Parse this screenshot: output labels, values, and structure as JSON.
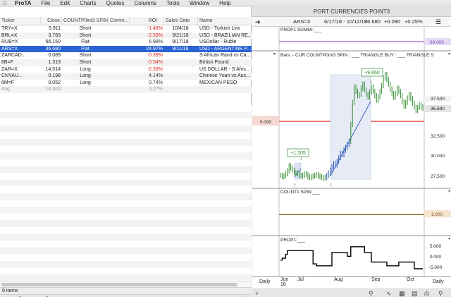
{
  "menubar": {
    "apple_icon": "apple-icon",
    "app_name": "ProTA",
    "items": [
      "File",
      "Edit",
      "Charts",
      "Quotes",
      "Columns",
      "Tools",
      "Window",
      "Help"
    ]
  },
  "table": {
    "columns": [
      "Ticker",
      "Close",
      "COUNTP0int3 SPIN",
      "Comm...",
      "ROI",
      "Sales Date",
      "Name"
    ],
    "rows": [
      {
        "ticker": "TRY=X",
        "close": "5.911",
        "spin": "Short",
        "comm": "",
        "roi": "-1.48%",
        "date": "10/4/18",
        "name": "USD - Turkish Lira"
      },
      {
        "ticker": "BRL=X",
        "close": "3.783",
        "spin": "Short",
        "comm": "",
        "roi": "-2.59%",
        "date": "9/21/18",
        "name": "USD - BRAZILIAN RE..."
      },
      {
        "ticker": "RUB=X",
        "close": "66.150",
        "spin": "Flat",
        "comm": "",
        "roi": "6.98%",
        "date": "9/17/18",
        "name": "USDollar - Ruble"
      },
      {
        "ticker": "ARS=X",
        "close": "36.680",
        "spin": "Flat",
        "comm": "",
        "roi": "24.97%",
        "date": "9/11/18",
        "name": "USD - ARGENTINE P..."
      },
      {
        "ticker": "ZARCAD...",
        "close": "0.089",
        "spin": "Short",
        "comm": "",
        "roi": "-0.39%",
        "date": "",
        "name": "S African Rand vs Ca..."
      },
      {
        "ticker": "6B=F",
        "close": "1.319",
        "spin": "Short",
        "comm": "",
        "roi": "-0.54%",
        "date": "",
        "name": "British Pound"
      },
      {
        "ticker": "ZAR=X",
        "close": "14.514",
        "spin": "Long",
        "comm": "",
        "roi": "-2.39%",
        "date": "",
        "name": "US DOLLAR - S Afric..."
      },
      {
        "ticker": "CNYAU...",
        "close": "0.198",
        "spin": "Long",
        "comm": "",
        "roi": "4.14%",
        "date": "",
        "name": "Chinese Yuan vs Aus..."
      },
      {
        "ticker": "6M=F",
        "close": "0.052",
        "spin": "Long",
        "comm": "",
        "roi": "0.74%",
        "date": "",
        "name": "MEXICAN PESO"
      }
    ],
    "avg": {
      "label": "Avg",
      "close": "14.300",
      "roi": "3.27%"
    },
    "selected_index": 3
  },
  "status": {
    "items_count": "9 items"
  },
  "chart": {
    "window_title": "PORT CURRENCIES POINT3",
    "ticker": "ARS=X",
    "date_range": "6/17/18 - 10/12/18",
    "last": "36.680",
    "change": "+0.090",
    "change_pct": "+0.25%",
    "panel1_label": "PROP1 SUM60:___",
    "panel1_value": "60.000",
    "panel2_label": "Bars:  - CUR COUNTP0int3 SPIN : ___  TRIANGLE BUY : ___  TRIANGLE S",
    "panel2_left_value": "0.000",
    "panel2_ticks": [
      "37.500",
      "35.000",
      "32.500",
      "30.000",
      "27.500"
    ],
    "panel2_last": "36.680",
    "annotation_1": "+1.205",
    "annotation_2": "+9.660",
    "panel3_label": "COUNT1 SPIN:___",
    "panel3_value": "1.000",
    "panel4_label": "PROP1:___",
    "panel4_ticks": [
      "5.000",
      "0.000",
      "-5.000"
    ],
    "x_labels": [
      "Jun",
      "Jul",
      "Aug",
      "Sep",
      "Oct"
    ],
    "x_year": "18",
    "period_left": "Daily",
    "period_right": "Daily"
  },
  "chart_data": {
    "type": "line",
    "title": "",
    "xlabel": "",
    "ylabel": "",
    "ylim": [
      26.5,
      42.5
    ],
    "price_series": {
      "name": "",
      "x": [
        0,
        1,
        2,
        3,
        4,
        5,
        6,
        7,
        8,
        9,
        10,
        11,
        12,
        13,
        14,
        15,
        16,
        17,
        18,
        19,
        20,
        21,
        22,
        23,
        24,
        25,
        26,
        27,
        28,
        29,
        30,
        31,
        32,
        33,
        34,
        35,
        36,
        37,
        38,
        39,
        40,
        41,
        42,
        43,
        44,
        45,
        46,
        47,
        48,
        49,
        50,
        51,
        52,
        53,
        54,
        55,
        56,
        57,
        58,
        59,
        60,
        61,
        62,
        63,
        64,
        65,
        66,
        67,
        68,
        69,
        70,
        71,
        72,
        73,
        74,
        75,
        76,
        77,
        78,
        79,
        80,
        81,
        82,
        83
      ],
      "values": [
        27.6,
        27.4,
        27.5,
        27.8,
        28.2,
        28.9,
        28.6,
        28.3,
        28.0,
        27.9,
        27.8,
        27.6,
        27.5,
        27.6,
        27.8,
        27.7,
        27.4,
        27.3,
        27.4,
        27.5,
        27.6,
        27.7,
        27.5,
        27.4,
        27.3,
        27.2,
        27.3,
        27.6,
        27.9,
        28.3,
        28.8,
        29.2,
        29.0,
        29.5,
        30.0,
        30.6,
        30.4,
        31.0,
        31.4,
        31.8,
        32.2,
        34.5,
        37.5,
        39.6,
        39.0,
        38.4,
        38.6,
        39.4,
        40.0,
        39.2,
        38.6,
        38.2,
        38.9,
        39.6,
        39.0,
        38.4,
        37.8,
        38.3,
        39.0,
        39.8,
        40.8,
        41.3,
        40.6,
        40.0,
        39.3,
        38.7,
        38.2,
        38.7,
        39.4,
        39.0,
        38.4,
        37.6,
        37.0,
        37.5,
        38.1,
        38.6,
        38.0,
        37.4,
        36.9,
        36.4,
        36.8,
        37.2,
        36.9,
        36.7
      ]
    },
    "prop1_series": {
      "name": "",
      "x": [
        0,
        1,
        2,
        3,
        4,
        5,
        6,
        7,
        8,
        9,
        10,
        11,
        12,
        13,
        14,
        15,
        16,
        17,
        18,
        19,
        20,
        21,
        22,
        23,
        24,
        25,
        26,
        27,
        28,
        29,
        30,
        31,
        32,
        33,
        34,
        35,
        36,
        37,
        38,
        39,
        40,
        41,
        42,
        43,
        44,
        45,
        46,
        47,
        48,
        49,
        50,
        51,
        52,
        53,
        54,
        55,
        56,
        57,
        58,
        59,
        60,
        61,
        62,
        63,
        64,
        65,
        66,
        67,
        68,
        69,
        70,
        71,
        72,
        73,
        74,
        75,
        76,
        77,
        78,
        79,
        80,
        81,
        82,
        83
      ],
      "values": [
        -1,
        0,
        0,
        2,
        4,
        4,
        4,
        4,
        4,
        4,
        4,
        4,
        4,
        4,
        4,
        4,
        4,
        4,
        4,
        -3,
        -3,
        -4,
        -4,
        -4,
        -4,
        -4,
        -4,
        -4,
        -4,
        -4,
        3,
        3,
        3,
        3,
        3,
        3,
        3,
        3,
        3,
        1,
        1,
        6,
        6,
        6,
        6,
        6,
        6,
        6,
        6,
        3,
        3,
        3,
        3,
        -2,
        -2,
        -2,
        -2,
        -2,
        -2,
        -2,
        -2,
        -2,
        -4,
        -4,
        -4,
        -4,
        -4,
        -4,
        -4,
        -2,
        -2,
        -2,
        -2,
        -2,
        -2,
        -2,
        -2,
        -2,
        -6,
        -6,
        -6,
        -6,
        -6,
        -6
      ]
    },
    "x_ticks": [
      "Jun",
      "Jul",
      "Aug",
      "Sep",
      "Oct"
    ],
    "y_ticks": [
      "37.500",
      "35.000",
      "32.500",
      "30.000",
      "27.500"
    ],
    "grid": false
  }
}
